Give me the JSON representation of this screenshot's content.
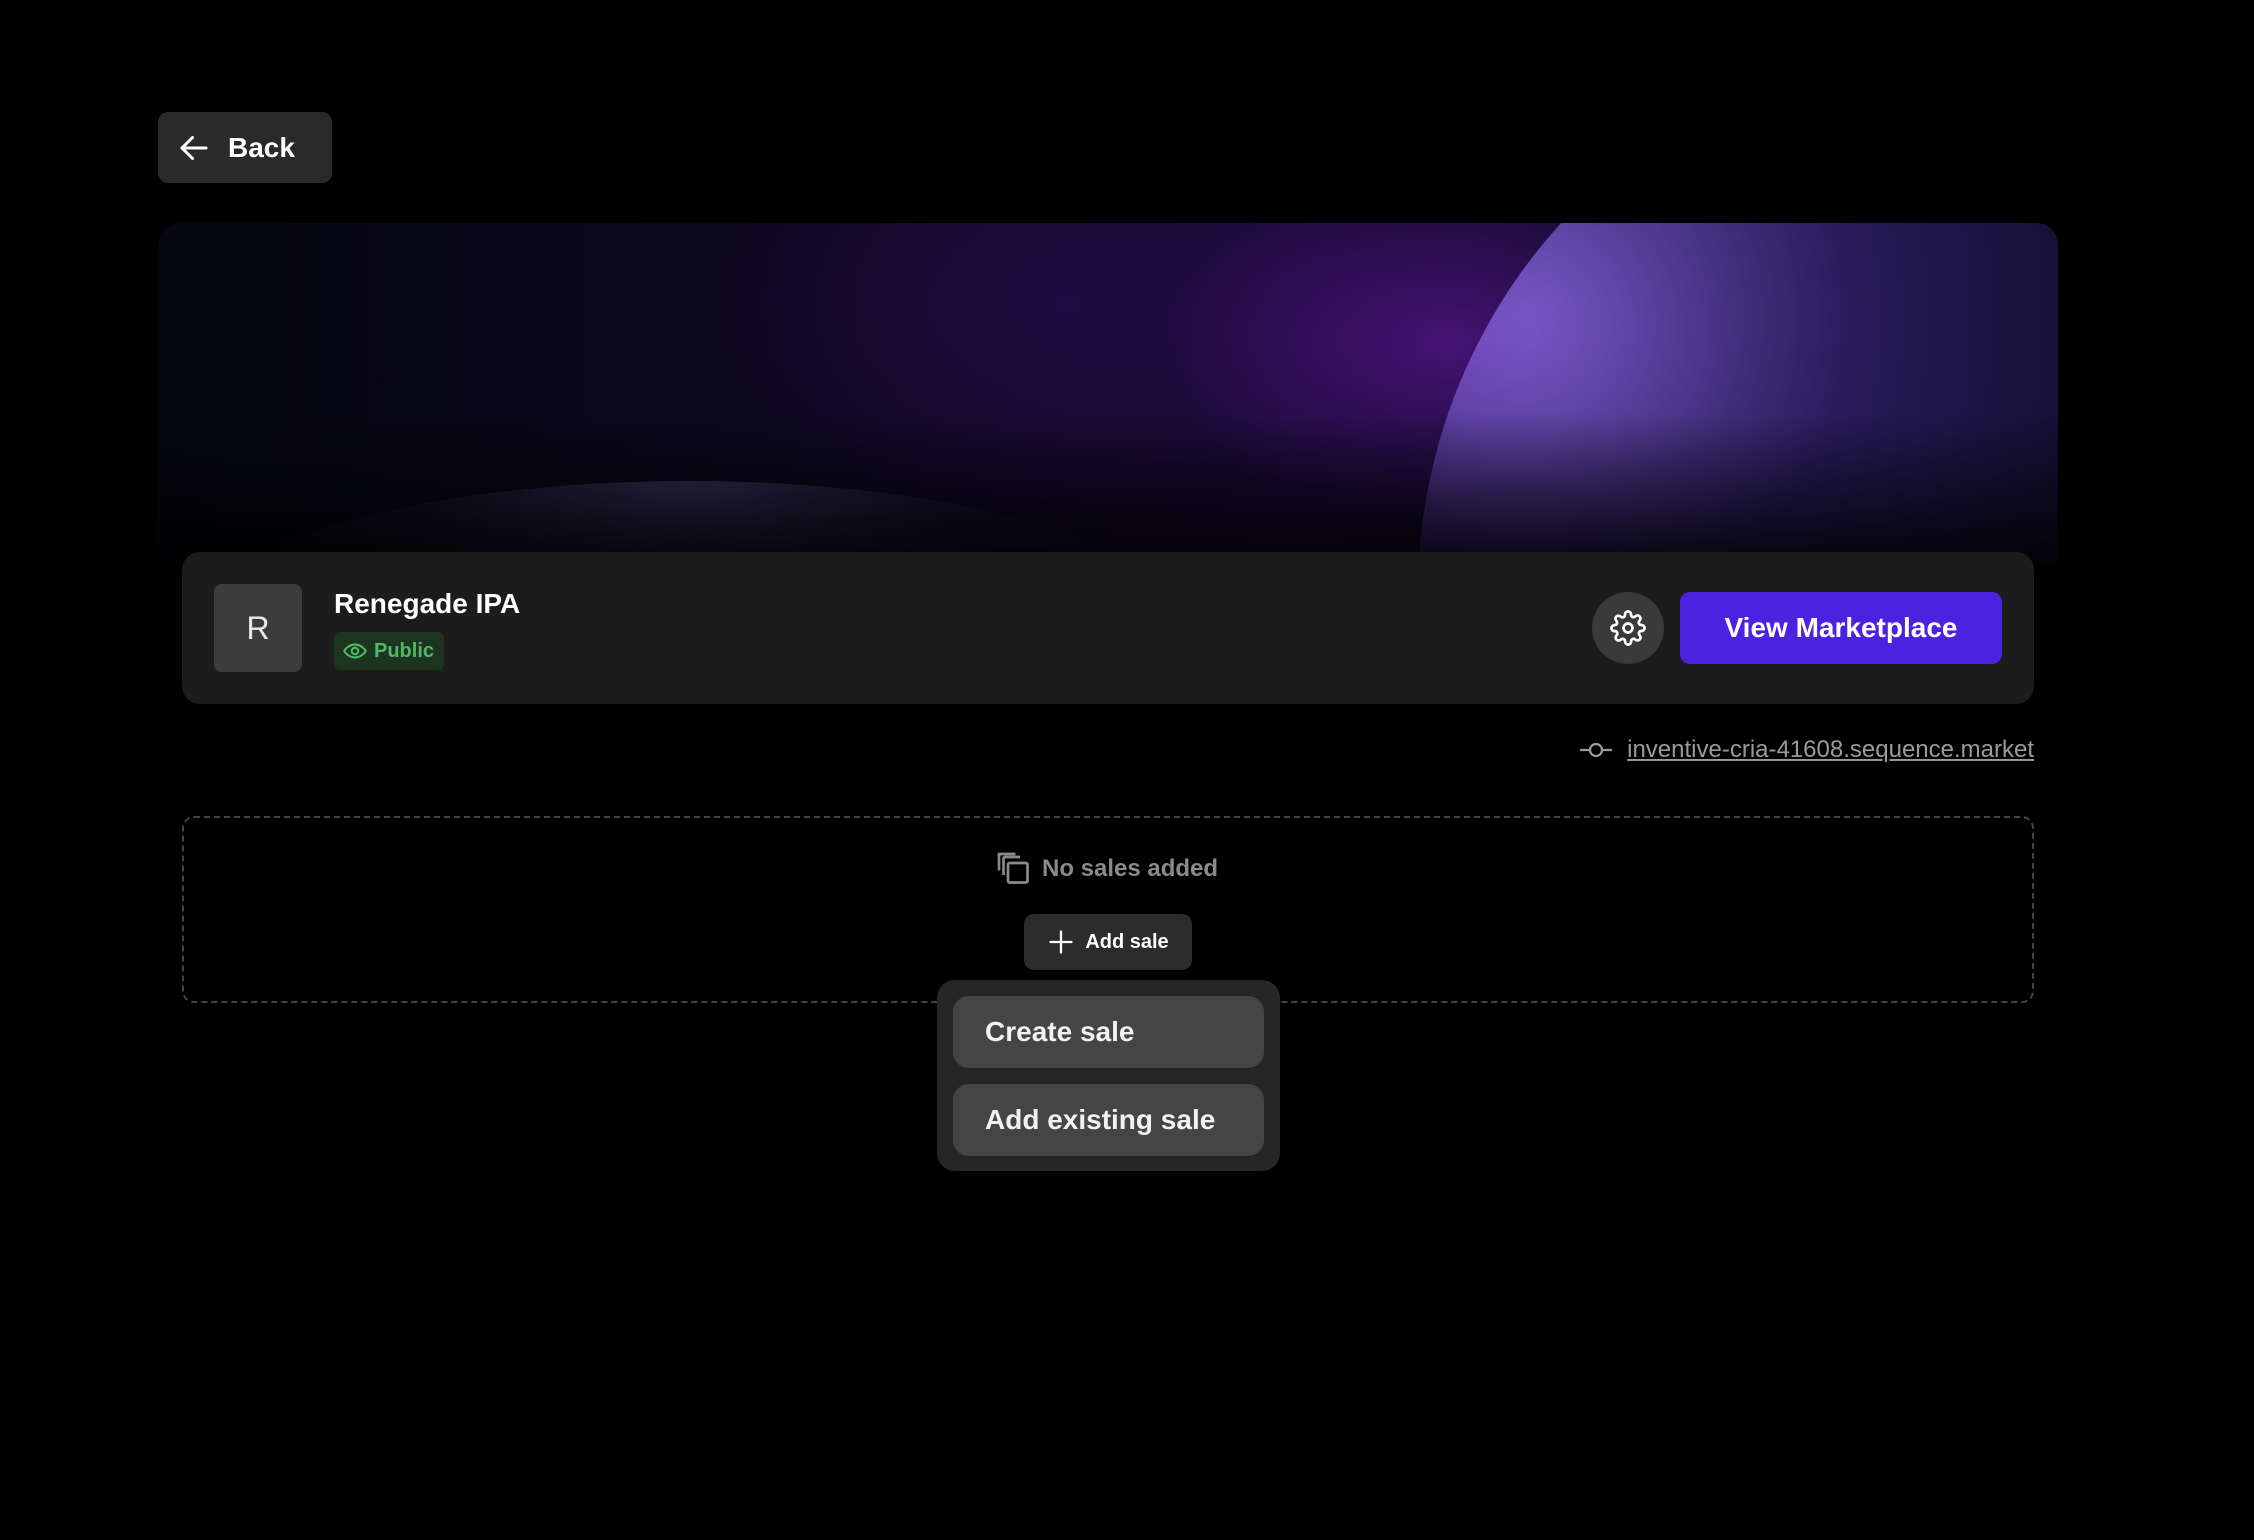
{
  "nav": {
    "back_label": "Back"
  },
  "collection": {
    "avatar_letter": "R",
    "name": "Renegade IPA",
    "status": "Public"
  },
  "actions": {
    "view_marketplace_label": "View Marketplace"
  },
  "domain": {
    "url": "inventive-cria-41608.sequence.market"
  },
  "sales": {
    "empty_message": "No sales added",
    "add_sale_label": "Add sale",
    "menu": [
      {
        "label": "Create sale"
      },
      {
        "label": "Add existing sale"
      }
    ]
  },
  "icons": {
    "back": "arrow-left-icon",
    "status": "eye-icon",
    "settings": "gear-icon",
    "domain": "commit-icon",
    "empty": "copy-icon",
    "add": "plus-icon"
  },
  "colors": {
    "background": "#000000",
    "card": "#1c1c1c",
    "accent": "#4a22e0",
    "public_badge_text": "#4cbb63",
    "public_badge_bg": "#1c3420"
  }
}
